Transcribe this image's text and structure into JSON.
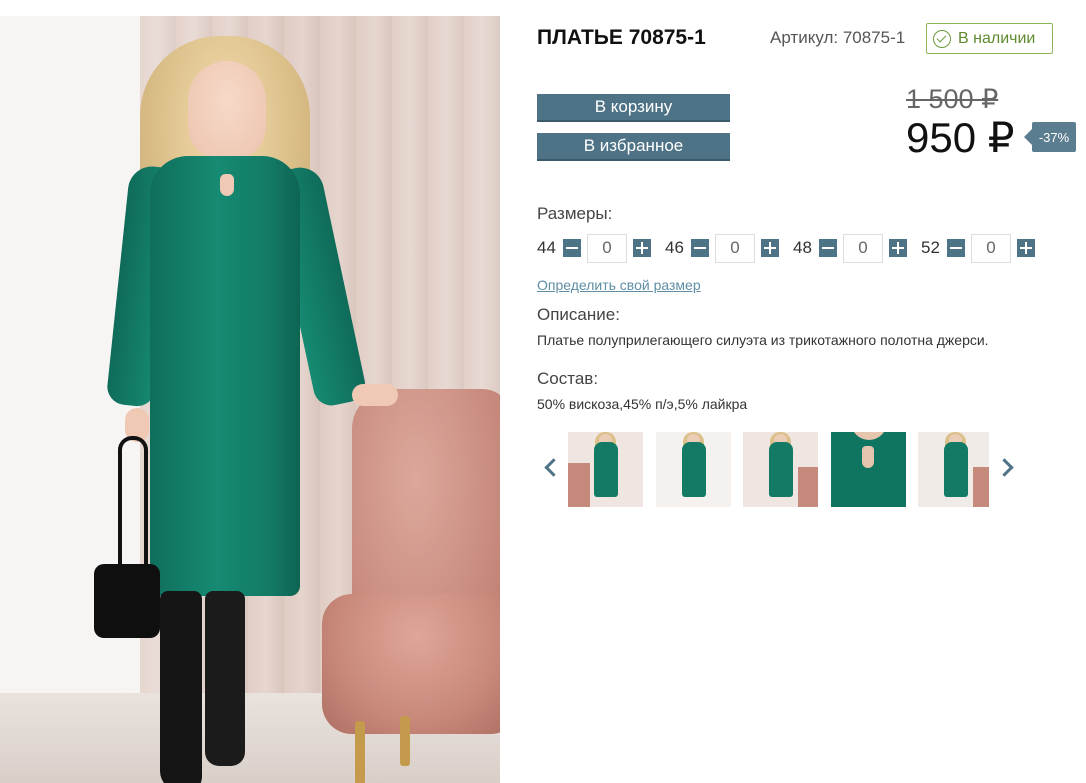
{
  "product": {
    "title": "ПЛАТЬЕ 70875-1",
    "sku_label": "Артикул: 70875-1",
    "stock_status": "В наличии"
  },
  "actions": {
    "cart_label": "В корзину",
    "favorite_label": "В избранное"
  },
  "price": {
    "old": "1 500 ₽",
    "current": "950 ₽",
    "discount": "-37%"
  },
  "sizes": {
    "label": "Размеры:",
    "items": [
      {
        "size": "44",
        "qty": "0"
      },
      {
        "size": "46",
        "qty": "0"
      },
      {
        "size": "48",
        "qty": "0"
      },
      {
        "size": "52",
        "qty": "0"
      }
    ],
    "find_size_link": "Определить свой размер"
  },
  "description": {
    "label": "Описание:",
    "text": "Платье полуприлегающего силуэта из трикотажного полотна джерси."
  },
  "composition": {
    "label": "Состав:",
    "text": "50% вискоза,45% п/э,5% лайкра"
  },
  "gallery": {
    "prev_icon": "chevron-left-icon",
    "next_icon": "chevron-right-icon",
    "thumbnails": [
      "full-length-seated",
      "full-length-front",
      "full-length-with-bag",
      "neckline-closeup",
      "full-length-side"
    ]
  },
  "colors": {
    "button": "#4f7386",
    "stock": "#6c9a3d",
    "dress": "#137a65"
  }
}
